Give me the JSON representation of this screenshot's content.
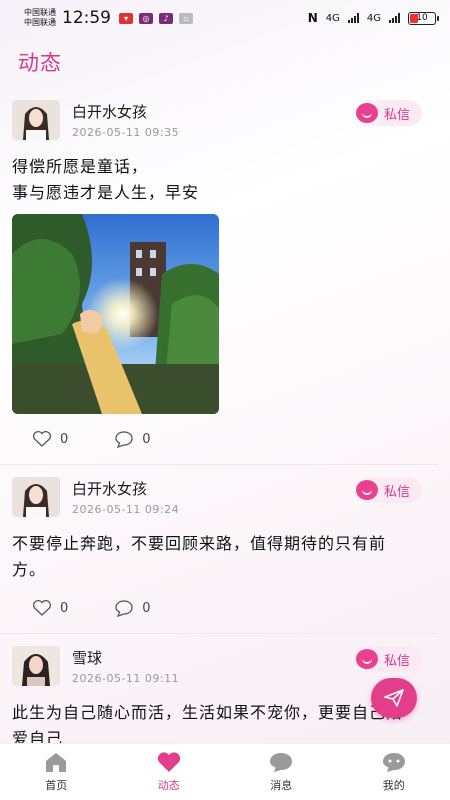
{
  "status_bar": {
    "carrier_1": "中国联通",
    "carrier_2": "中国联通",
    "time": "12:59",
    "network_1": "4G",
    "network_2": "4G",
    "battery": "10"
  },
  "header": {
    "title": "动态"
  },
  "posts": [
    {
      "username": "白开水女孩",
      "time": "2026-05-11 09:35",
      "dm_label": "私信",
      "text_lines": [
        "得偿所愿是童话，",
        "事与愿违才是人生，早安"
      ],
      "has_image": true,
      "likes": "0",
      "comments": "0"
    },
    {
      "username": "白开水女孩",
      "time": "2026-05-11 09:24",
      "dm_label": "私信",
      "text_lines": [
        "不要停止奔跑，不要回顾来路，值得期待的只有前",
        "方。"
      ],
      "has_image": false,
      "likes": "0",
      "comments": "0"
    },
    {
      "username": "雪球",
      "time": "2026-05-11 09:11",
      "dm_label": "私信",
      "text_lines": [
        "此生为自己随心而活，生活如果不宠你，更要自己陪",
        "爱自己"
      ],
      "has_image": false,
      "likes": "",
      "comments": ""
    }
  ],
  "tabbar": {
    "items": [
      {
        "label": "首页",
        "icon": "home-icon",
        "active": false
      },
      {
        "label": "动态",
        "icon": "heart-icon",
        "active": true
      },
      {
        "label": "消息",
        "icon": "chat-icon",
        "active": false
      },
      {
        "label": "我的",
        "icon": "profile-icon",
        "active": false
      }
    ]
  },
  "colors": {
    "accent": "#d63a8a",
    "fab": "#e23e8c"
  }
}
